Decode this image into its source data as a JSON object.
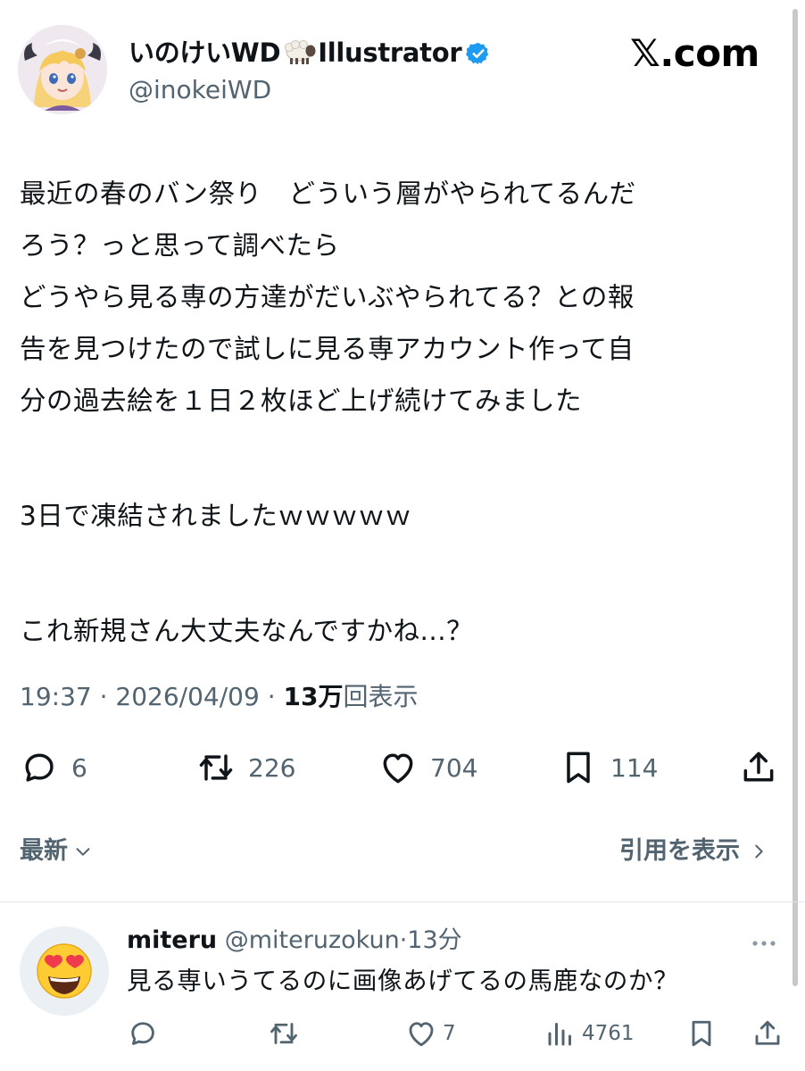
{
  "tweet": {
    "display_name": "いのけいWD",
    "display_name_suffix": "Illustrator",
    "handle": "@inokeiWD",
    "brand": "𝕏.com",
    "text_lines": [
      "最近の春のバン祭り　どういう層がやられてるんだ",
      "ろう？っと思って調べたら",
      "どうやら見る専の方達がだいぶやられてる？との報",
      "告を見つけたので試しに見る専アカウント作って自",
      "分の過去絵を１日２枚ほど上げ続けてみました"
    ],
    "text_line_6": "3日で凍結されましたｗｗｗｗｗ",
    "text_line_7": "これ新規さん大丈夫なんですかね...？",
    "time": "19:37",
    "separator": " · ",
    "date": "2026/04/09",
    "views_count": "13万",
    "views_label": "回表示",
    "actions": {
      "reply": {
        "icon": "reply-icon",
        "count": "6"
      },
      "repost": {
        "icon": "repost-icon",
        "count": "226"
      },
      "like": {
        "icon": "heart-icon",
        "count": "704"
      },
      "bookmark": {
        "icon": "bookmark-icon",
        "count": "114"
      },
      "share": {
        "icon": "share-icon"
      }
    },
    "sort_label": "最新",
    "quotes_label": "引用を表示"
  },
  "reply": {
    "name": "miteru",
    "handle": "@miteruzokun",
    "separator": "·",
    "time": "13分",
    "text": "見る専いうてるのに画像あげてるの馬鹿なのか？",
    "avatar": "heart-eyes-emoji",
    "actions": {
      "reply": {
        "icon": "reply-icon"
      },
      "repost": {
        "icon": "repost-icon"
      },
      "like": {
        "icon": "heart-icon",
        "count": "7"
      },
      "views": {
        "icon": "views-chart-icon",
        "count": "4761"
      },
      "bookmark": {
        "icon": "bookmark-icon"
      },
      "share": {
        "icon": "share-icon"
      }
    }
  },
  "colors": {
    "text": "#0f1419",
    "muted": "#536471",
    "verified": "#1d9bf0",
    "divider": "#e1e6ea"
  }
}
